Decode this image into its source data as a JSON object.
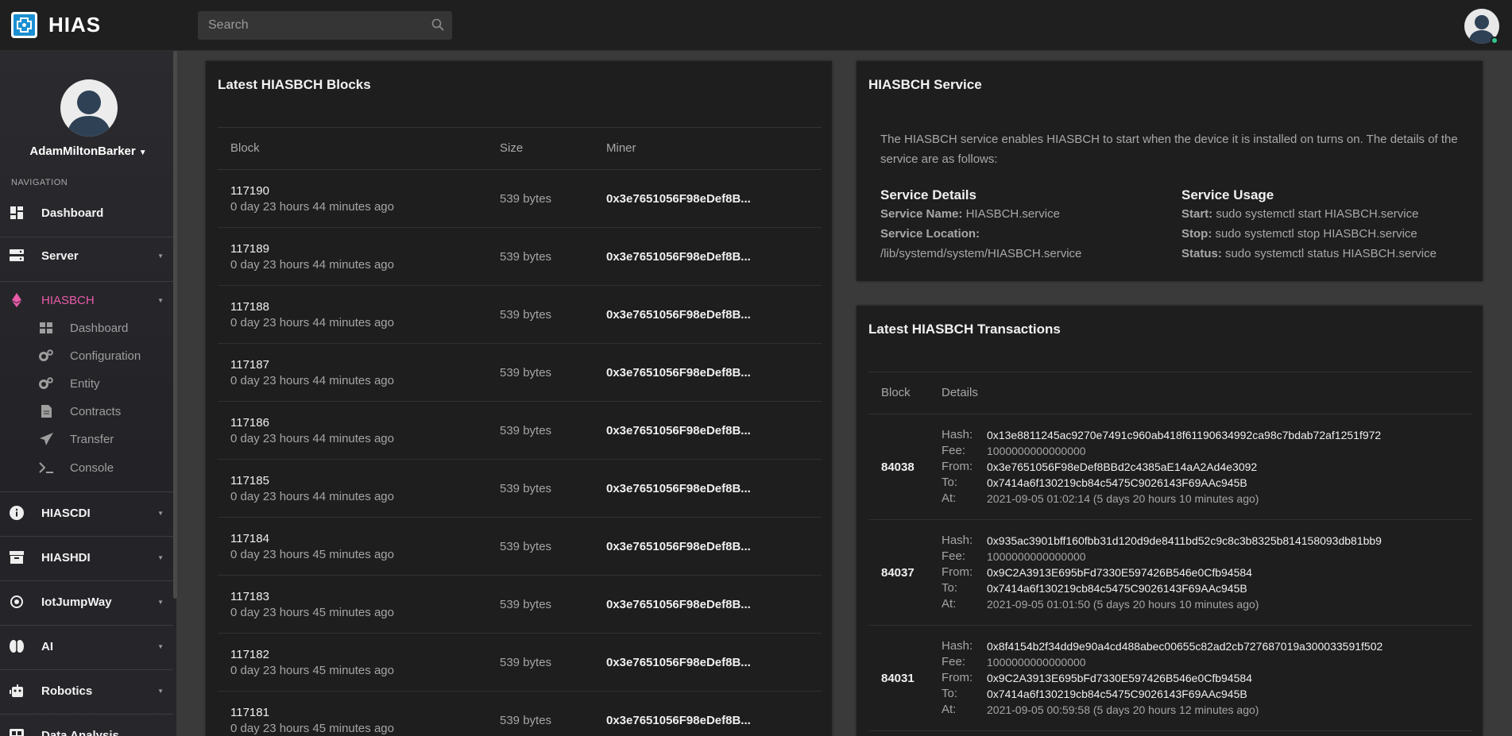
{
  "app": {
    "name": "HIAS"
  },
  "search": {
    "placeholder": "Search"
  },
  "profile": {
    "name": "AdamMiltonBarker"
  },
  "nav": {
    "heading": "NAVIGATION",
    "dashboard": "Dashboard",
    "server": "Server",
    "hiasbch": "HIASBCH",
    "hiasbch_sub": [
      "Dashboard",
      "Configuration",
      "Entity",
      "Contracts",
      "Transfer",
      "Console"
    ],
    "hiascdi": "HIASCDI",
    "hiashdi": "HIASHDI",
    "iotjumpway": "IotJumpWay",
    "ai": "AI",
    "robotics": "Robotics",
    "data_analysis": "Data Analysis"
  },
  "blocks": {
    "title": "Latest HIASBCH Blocks",
    "headers": [
      "Block",
      "Size",
      "Miner"
    ],
    "rows": [
      {
        "block": "117190",
        "time": "0 day 23 hours 44 minutes ago",
        "size": "539 bytes",
        "miner": "0x3e7651056F98eDef8B..."
      },
      {
        "block": "117189",
        "time": "0 day 23 hours 44 minutes ago",
        "size": "539 bytes",
        "miner": "0x3e7651056F98eDef8B..."
      },
      {
        "block": "117188",
        "time": "0 day 23 hours 44 minutes ago",
        "size": "539 bytes",
        "miner": "0x3e7651056F98eDef8B..."
      },
      {
        "block": "117187",
        "time": "0 day 23 hours 44 minutes ago",
        "size": "539 bytes",
        "miner": "0x3e7651056F98eDef8B..."
      },
      {
        "block": "117186",
        "time": "0 day 23 hours 44 minutes ago",
        "size": "539 bytes",
        "miner": "0x3e7651056F98eDef8B..."
      },
      {
        "block": "117185",
        "time": "0 day 23 hours 44 minutes ago",
        "size": "539 bytes",
        "miner": "0x3e7651056F98eDef8B..."
      },
      {
        "block": "117184",
        "time": "0 day 23 hours 45 minutes ago",
        "size": "539 bytes",
        "miner": "0x3e7651056F98eDef8B..."
      },
      {
        "block": "117183",
        "time": "0 day 23 hours 45 minutes ago",
        "size": "539 bytes",
        "miner": "0x3e7651056F98eDef8B..."
      },
      {
        "block": "117182",
        "time": "0 day 23 hours 45 minutes ago",
        "size": "539 bytes",
        "miner": "0x3e7651056F98eDef8B..."
      },
      {
        "block": "117181",
        "time": "0 day 23 hours 45 minutes ago",
        "size": "539 bytes",
        "miner": "0x3e7651056F98eDef8B..."
      }
    ]
  },
  "service": {
    "title": "HIASBCH Service",
    "description": "The HIASBCH service enables HIASBCH to start when the device it is installed on turns on. The details of the service are as follows:",
    "details_title": "Service Details",
    "name_label": "Service Name:",
    "name_value": "HIASBCH.service",
    "location_label": "Service Location:",
    "location_value": "/lib/systemd/system/HIASBCH.service",
    "usage_title": "Service Usage",
    "start_label": "Start:",
    "start_value": "sudo systemctl start HIASBCH.service",
    "stop_label": "Stop:",
    "stop_value": "sudo systemctl stop HIASBCH.service",
    "status_label": "Status:",
    "status_value": "sudo systemctl status HIASBCH.service"
  },
  "transactions": {
    "title": "Latest HIASBCH Transactions",
    "headers": [
      "Block",
      "Details"
    ],
    "field_labels": {
      "hash": "Hash:",
      "fee": "Fee:",
      "from": "From:",
      "to": "To:",
      "at": "At:"
    },
    "rows": [
      {
        "block": "84038",
        "hash": "0x13e8811245ac9270e7491c960ab418f61190634992ca98c7bdab72af1251f972",
        "fee": "1000000000000000",
        "from": "0x3e7651056F98eDef8BBd2c4385aE14aA2Ad4e3092",
        "to": "0x7414a6f130219cb84c5475C9026143F69AAc945B",
        "at": "2021-09-05 01:02:14 (5 days 20 hours 10 minutes ago)"
      },
      {
        "block": "84037",
        "hash": "0x935ac3901bff160fbb31d120d9de8411bd52c9c8c3b8325b814158093db81bb9",
        "fee": "1000000000000000",
        "from": "0x9C2A3913E695bFd7330E597426B546e0Cfb94584",
        "to": "0x7414a6f130219cb84c5475C9026143F69AAc945B",
        "at": "2021-09-05 01:01:50 (5 days 20 hours 10 minutes ago)"
      },
      {
        "block": "84031",
        "hash": "0x8f4154b2f34dd9e90a4cd488abec00655c82ad2cb727687019a300033591f502",
        "fee": "1000000000000000",
        "from": "0x9C2A3913E695bFd7330E597426B546e0Cfb94584",
        "to": "0x7414a6f130219cb84c5475C9026143F69AAc945B",
        "at": "2021-09-05 00:59:58 (5 days 20 hours 12 minutes ago)"
      }
    ]
  },
  "colors": {
    "accent": "#e85aa8",
    "online": "#33c98f",
    "panel": "#1e1e1e",
    "background": "#3a3a3a"
  },
  "icons": [
    "search-icon",
    "dashboard-icon",
    "server-icon",
    "ethereum-icon",
    "grid-icon",
    "cogs-icon",
    "cog-icon",
    "document-icon",
    "paper-plane-icon",
    "terminal-icon",
    "info-icon",
    "archive-icon",
    "chip-icon",
    "brain-icon",
    "robot-icon",
    "chart-icon"
  ]
}
